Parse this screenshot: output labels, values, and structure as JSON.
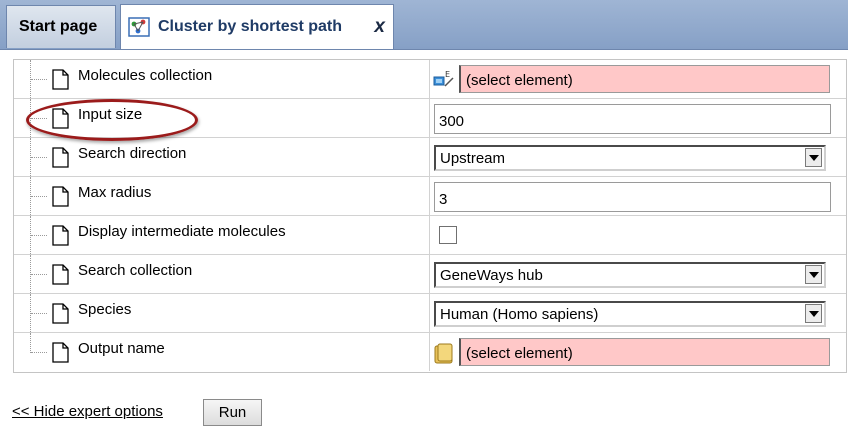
{
  "tabs": [
    {
      "label": "Start page",
      "active": false
    },
    {
      "label": "Cluster by shortest path",
      "active": true,
      "close": "x",
      "icon": "cluster-icon"
    }
  ],
  "parameters": [
    {
      "label": "Molecules collection",
      "kind": "element",
      "value": "(select element)",
      "icon": "molecule-collection-icon"
    },
    {
      "label": "Input size",
      "kind": "text",
      "value": "300",
      "highlighted": true
    },
    {
      "label": "Search direction",
      "kind": "select",
      "value": "Upstream"
    },
    {
      "label": "Max radius",
      "kind": "text",
      "value": "3"
    },
    {
      "label": "Display intermediate molecules",
      "kind": "checkbox",
      "checked": false
    },
    {
      "label": "Search collection",
      "kind": "select",
      "value": "GeneWays hub"
    },
    {
      "label": "Species",
      "kind": "select",
      "value": "Human (Homo sapiens)"
    },
    {
      "label": "Output name",
      "kind": "element",
      "value": "(select element)",
      "icon": "folder-icon"
    }
  ],
  "footer": {
    "hide_link": "<< Hide expert options",
    "run_label": "Run"
  },
  "colors": {
    "tabbar": "#9fb5d4",
    "active_tab_text": "#1f3b66",
    "required_field": "#ffc8c8",
    "highlight": "#9b1b1b"
  }
}
